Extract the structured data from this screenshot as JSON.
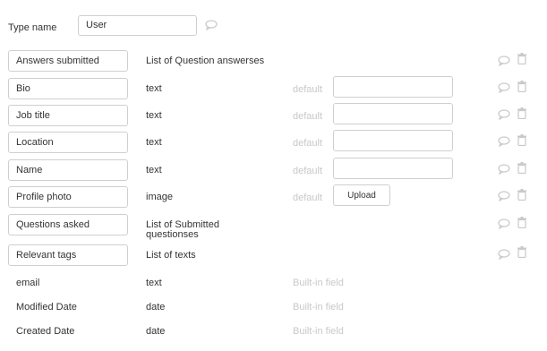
{
  "type_name": {
    "label": "Type name",
    "value": "User"
  },
  "fields": [
    {
      "name": "Answers submitted",
      "type": "List of Question answerses"
    },
    {
      "name": "Bio",
      "type": "text",
      "default_label": "default",
      "default_value": ""
    },
    {
      "name": "Job title",
      "type": "text",
      "default_label": "default",
      "default_value": ""
    },
    {
      "name": "Location",
      "type": "text",
      "default_label": "default",
      "default_value": ""
    },
    {
      "name": "Name",
      "type": "text",
      "default_label": "default",
      "default_value": ""
    },
    {
      "name": "Profile photo",
      "type": "image",
      "default_label": "default",
      "upload_label": "Upload"
    },
    {
      "name": "Questions asked",
      "type_line1": "List of Submitted",
      "type_line2": "questionses"
    },
    {
      "name": "Relevant tags",
      "type": "List of texts"
    }
  ],
  "builtin_fields": [
    {
      "name": "email",
      "type": "text",
      "note": "Built-in field"
    },
    {
      "name": "Modified Date",
      "type": "date",
      "note": "Built-in field"
    },
    {
      "name": "Created Date",
      "type": "date",
      "note": "Built-in field"
    }
  ],
  "icons": {
    "comment": "comment-bubble-icon",
    "delete": "trash-icon"
  },
  "colors": {
    "border": "#cfcfcf",
    "placeholder_text": "#c8c8c8",
    "icon": "#c9c9c9"
  }
}
